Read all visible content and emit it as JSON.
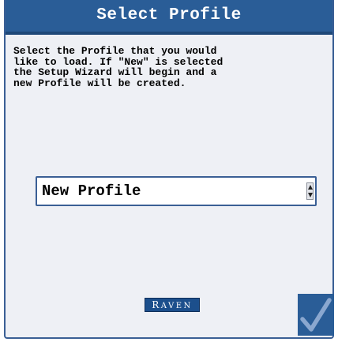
{
  "dialog": {
    "title": "Select Profile",
    "instructions": "Select the Profile that you would\nlike to load. If \"New\" is selected\nthe Setup Wizard will begin and a\nnew Profile will be created.",
    "profile_select": {
      "selected_value": "New Profile"
    },
    "brand": {
      "first_letter": "R",
      "rest": "AVEN"
    },
    "ok_icon": "checkmark-icon"
  },
  "colors": {
    "title_bar": "#2a5d97",
    "dialog_background": "#eef0f5",
    "accent_border": "#3a5f95",
    "checkmark": "#8aa7cf"
  }
}
